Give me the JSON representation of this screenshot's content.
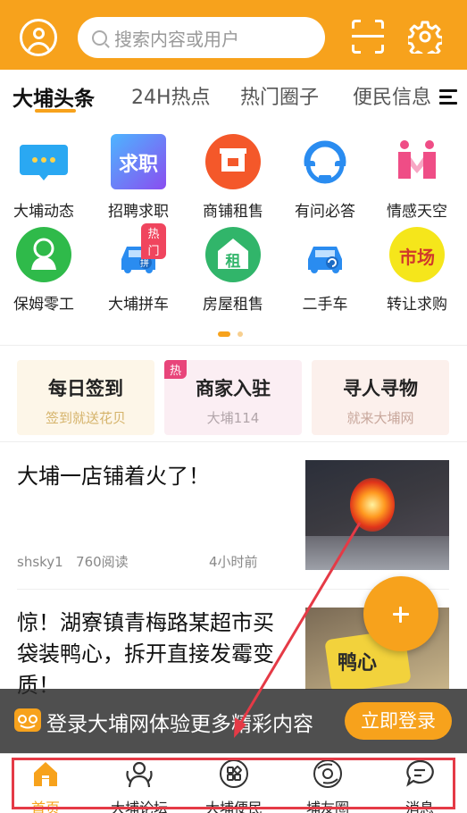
{
  "header": {
    "search_placeholder": "搜索内容或用户",
    "bg_color": "#f7a21c"
  },
  "tabs": [
    {
      "label": "大埔头条",
      "active": true
    },
    {
      "label": "24H热点",
      "active": false
    },
    {
      "label": "热门圈子",
      "active": false
    },
    {
      "label": "便民信息",
      "active": false
    }
  ],
  "grid": [
    {
      "label": "大埔动态",
      "icon": "chat-bubble-icon",
      "color": "#2aa8f2"
    },
    {
      "label": "招聘求职",
      "icon": "job-icon",
      "color": "#6a5cf0",
      "icon_text": "求职"
    },
    {
      "label": "商铺租售",
      "icon": "shop-icon",
      "color": "#f4582a"
    },
    {
      "label": "有问必答",
      "icon": "headset-icon",
      "color": "#2a8cf0"
    },
    {
      "label": "情感天空",
      "icon": "hearts-icon",
      "color": "#ef4d86"
    },
    {
      "label": "保姆零工",
      "icon": "nanny-icon",
      "color": "#2fba4a"
    },
    {
      "label": "大埔拼车",
      "icon": "carpool-icon",
      "color": "#2a8cf0",
      "badge": "热门",
      "icon_text": "拼"
    },
    {
      "label": "房屋租售",
      "icon": "house-icon",
      "color": "#31b56a",
      "icon_text": "租"
    },
    {
      "label": "二手车",
      "icon": "used-car-icon",
      "color": "#2a8cf0"
    },
    {
      "label": "转让求购",
      "icon": "market-icon",
      "color": "#f5e61b",
      "icon_text": "市场"
    }
  ],
  "cards": [
    {
      "title": "每日签到",
      "subtitle": "签到就送花贝",
      "bg": "#fdf6e8",
      "sub_color": "#d5b36a"
    },
    {
      "title": "商家入驻",
      "subtitle": "大埔114",
      "bg": "#fbeef3",
      "sub_color": "#b2a5aa",
      "tag": "热"
    },
    {
      "title": "寻人寻物",
      "subtitle": "就来大埔网",
      "bg": "#fcf0ec",
      "sub_color": "#c8a79c"
    }
  ],
  "articles": [
    {
      "title": "大埔一店铺着火了！",
      "author": "shsky1",
      "reads": "760阅读",
      "time": "4小时前"
    },
    {
      "title": "惊！湖寮镇青梅路某超市买袋装鸭心，拆开直接发霉变质！",
      "thumb_text": "鸭心"
    }
  ],
  "login_bar": {
    "text": "登录大埔网体验更多精彩内容",
    "button": "立即登录"
  },
  "bottom_nav": [
    {
      "label": "首页",
      "icon": "home-icon",
      "active": true
    },
    {
      "label": "大埔论坛",
      "icon": "forum-icon",
      "active": false
    },
    {
      "label": "大埔便民",
      "icon": "services-grid-icon",
      "active": false
    },
    {
      "label": "埔友圈",
      "icon": "moments-icon",
      "active": false
    },
    {
      "label": "消息",
      "icon": "message-icon",
      "active": false
    }
  ],
  "accent_color": "#f7a21c",
  "annotation_color": "#e53a46"
}
